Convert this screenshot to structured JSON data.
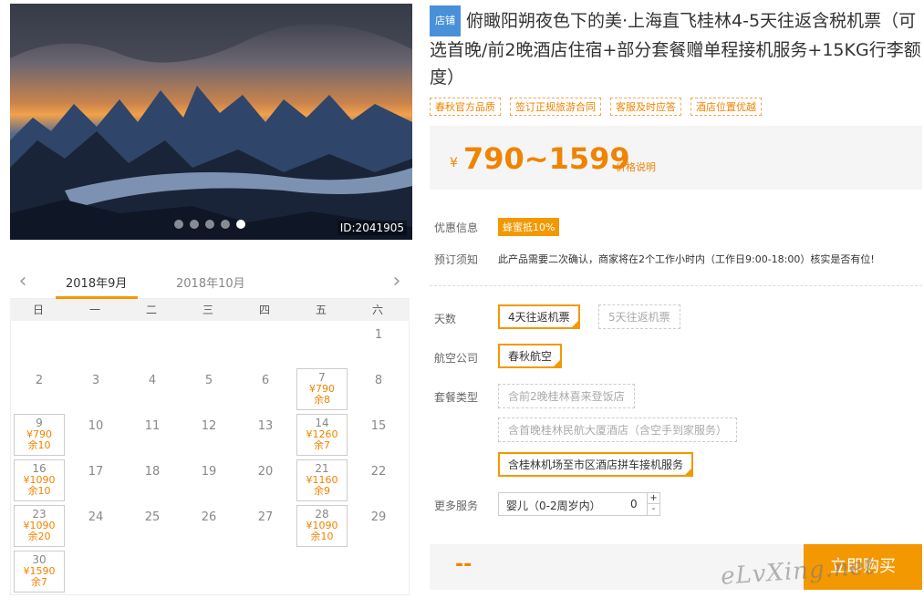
{
  "hero": {
    "id_label": "ID:2041905",
    "dots": 5,
    "active_dot": 4
  },
  "calendar": {
    "month_current": "2018年9月",
    "month_next": "2018年10月",
    "weekdays": [
      "日",
      "一",
      "二",
      "三",
      "四",
      "五",
      "六"
    ],
    "cells": [
      {
        "day": ""
      },
      {
        "day": ""
      },
      {
        "day": ""
      },
      {
        "day": ""
      },
      {
        "day": ""
      },
      {
        "day": ""
      },
      {
        "day": "1"
      },
      {
        "day": "2"
      },
      {
        "day": "3"
      },
      {
        "day": "4"
      },
      {
        "day": "5"
      },
      {
        "day": "6"
      },
      {
        "day": "7",
        "price": "¥790",
        "stock": "余8"
      },
      {
        "day": "8"
      },
      {
        "day": "9",
        "price": "¥790",
        "stock": "余10"
      },
      {
        "day": "10"
      },
      {
        "day": "11"
      },
      {
        "day": "12"
      },
      {
        "day": "13"
      },
      {
        "day": "14",
        "price": "¥1260",
        "stock": "余7"
      },
      {
        "day": "15"
      },
      {
        "day": "16",
        "price": "¥1090",
        "stock": "余10"
      },
      {
        "day": "17"
      },
      {
        "day": "18"
      },
      {
        "day": "19"
      },
      {
        "day": "20"
      },
      {
        "day": "21",
        "price": "¥1160",
        "stock": "余9"
      },
      {
        "day": "22"
      },
      {
        "day": "23",
        "price": "¥1090",
        "stock": "余20"
      },
      {
        "day": "24"
      },
      {
        "day": "25"
      },
      {
        "day": "26"
      },
      {
        "day": "27"
      },
      {
        "day": "28",
        "price": "¥1090",
        "stock": "余10"
      },
      {
        "day": "29"
      },
      {
        "day": "30",
        "price": "¥1590",
        "stock": "余7"
      }
    ]
  },
  "product": {
    "shop_badge": "店铺",
    "title": "俯瞰阳朔夜色下的美·上海直飞桂林4-5天往返含税机票（可选首晚/前2晚酒店住宿+部分套餐赠单程接机服务+15KG行李额度）",
    "tags": [
      "春秋官方品质",
      "签订正规旅游合同",
      "客服及时应答",
      "酒店位置优越"
    ],
    "currency": "¥",
    "price_range": "790~1599",
    "price_note": "价格说明"
  },
  "info": {
    "promo_label": "优惠信息",
    "promo_badge": "蜂蜜抵10%",
    "notice_label": "预订须知",
    "notice_text": "此产品需要二次确认，商家将在2个工作小时内（工作日9:00-18:00）核实是否有位!"
  },
  "options": {
    "days_label": "天数",
    "days": [
      "4天往返机票",
      "5天往返机票"
    ],
    "airline_label": "航空公司",
    "airline": "春秋航空",
    "package_label": "套餐类型",
    "packages": [
      "含前2晚桂林喜来登饭店",
      "含首晚桂林民航大厦酒店（含空手到家服务）",
      "含桂林机场至市区酒店拼车接机服务"
    ],
    "more_label": "更多服务",
    "infant_label": "婴儿（0-2周岁内）",
    "infant_count": "0",
    "plus": "+",
    "minus": "-"
  },
  "buy": {
    "total": "--",
    "button": "立即购买"
  },
  "watermark": "eLvXing.net"
}
